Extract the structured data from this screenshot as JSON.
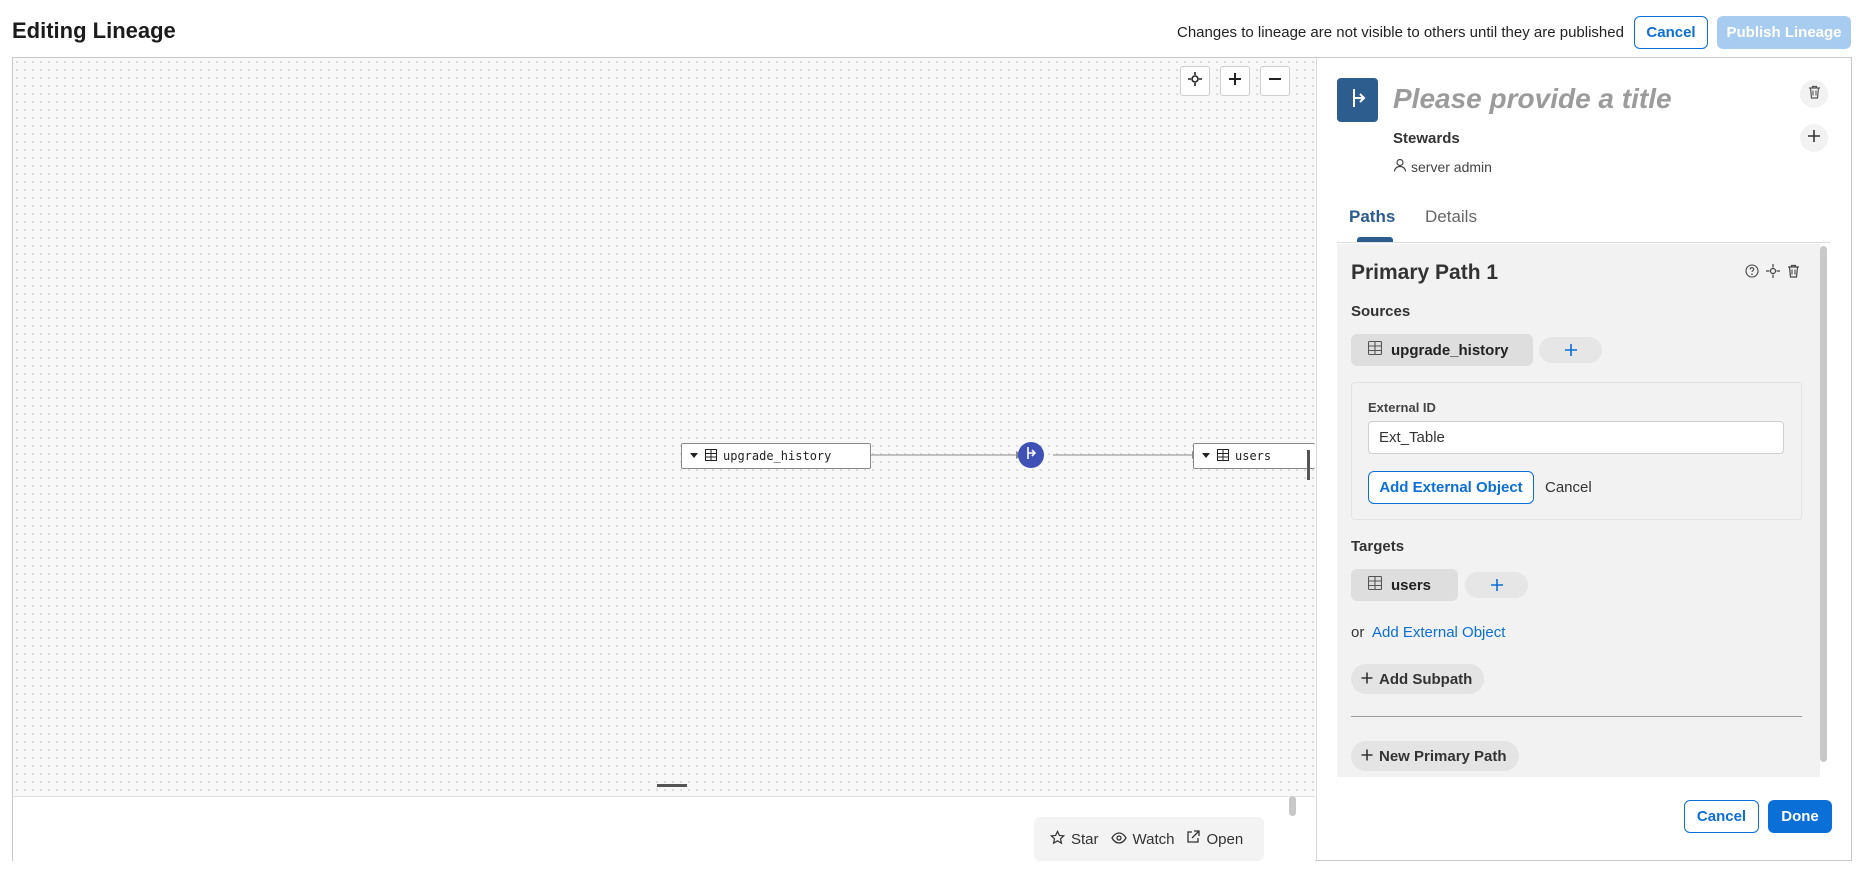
{
  "header": {
    "title": "Editing Lineage",
    "notice": "Changes to lineage are not visible to others until they are published",
    "cancel_label": "Cancel",
    "publish_label": "Publish Lineage"
  },
  "canvas": {
    "source_node": "upgrade_history",
    "target_node": "users"
  },
  "mini_toolbar": {
    "star": "Star",
    "watch": "Watch",
    "open": "Open"
  },
  "panel": {
    "title_placeholder": "Please provide a title",
    "stewards_label": "Stewards",
    "steward_name": "server admin",
    "tabs": [
      {
        "label": "Paths",
        "active": true
      },
      {
        "label": "Details",
        "active": false
      }
    ],
    "path": {
      "title": "Primary Path 1",
      "sources_label": "Sources",
      "source_chip": "upgrade_history",
      "external_id_label": "External ID",
      "external_id_value": "Ext_Table",
      "add_external_object_label": "Add External Object",
      "cancel_label": "Cancel",
      "targets_label": "Targets",
      "target_chip": "users",
      "or_label": "or",
      "add_external_object_link": "Add External Object",
      "add_subpath_label": "Add Subpath",
      "new_primary_path_label": "New Primary Path"
    },
    "footer": {
      "cancel_label": "Cancel",
      "done_label": "Done"
    }
  },
  "colors": {
    "accent": "#0b6fd8",
    "brand_icon": "#2d5c8f",
    "process_node": "#3f51b5"
  }
}
